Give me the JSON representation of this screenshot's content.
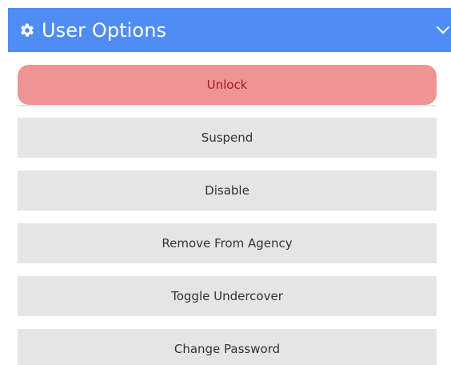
{
  "panel": {
    "title": "User Options",
    "icon": "gear-icon",
    "toggle_icon": "chevron-down-icon",
    "accent_color": "#4f8df5"
  },
  "actions": [
    {
      "label": "Unlock",
      "variant": "danger",
      "color": "#ef9494"
    },
    {
      "label": "Suspend",
      "variant": "default"
    },
    {
      "label": "Disable",
      "variant": "default"
    },
    {
      "label": "Remove From Agency",
      "variant": "default"
    },
    {
      "label": "Toggle Undercover",
      "variant": "default"
    },
    {
      "label": "Change Password",
      "variant": "default"
    }
  ]
}
